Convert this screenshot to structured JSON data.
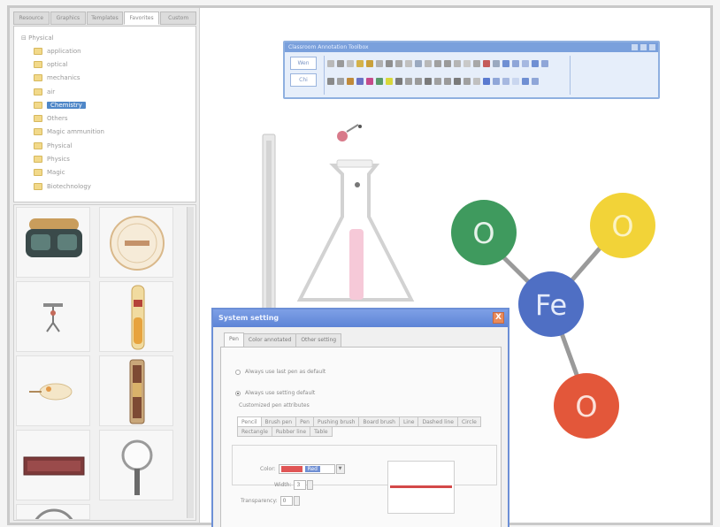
{
  "left_panel": {
    "tabs": [
      "Resource",
      "Graphics",
      "Templates",
      "Favorites",
      "Custom"
    ],
    "active_tab": 3,
    "tree": {
      "root": "Physical",
      "items": [
        "application",
        "optical",
        "mechanics",
        "air",
        "Chemistry",
        "Others",
        "Magic ammunition",
        "Physical",
        "Physics",
        "Magic",
        "Biotechnology"
      ],
      "selected": 4
    },
    "gallery_icons": [
      "goggles-icon",
      "thermometer-dial-icon",
      "tripod-icon",
      "test-tube-icon",
      "lamp-icon",
      "test-tube-rack-icon",
      "slide-icon",
      "magnifier-icon",
      "dial-icon"
    ]
  },
  "toolbar": {
    "title": "Classroom  Annotation  Toolbox",
    "mode_buttons": [
      "Wen",
      "Chi"
    ],
    "accent": "#8fb0e0"
  },
  "molecule": {
    "atoms": [
      {
        "label": "Fe",
        "color": "#4f6fc4"
      },
      {
        "label": "O",
        "color": "#3f9a5e"
      },
      {
        "label": "O",
        "color": "#f2d338"
      },
      {
        "label": "O",
        "color": "#e3573a"
      }
    ]
  },
  "dialog": {
    "title": "System setting",
    "close": "X",
    "tabs": [
      "Pen",
      "Color annotated",
      "Other setting"
    ],
    "active_tab": 0,
    "radio_1": "Always use last pen as default",
    "radio_2": "Always use setting default",
    "group_label": "Customized pen attributes",
    "pen_tabs": [
      "Pencil",
      "Brush pen",
      "Pen",
      "Pushing brush",
      "Board brush",
      "Line",
      "Dashed line",
      "Circle",
      "Rectangle",
      "Rubber line",
      "Table"
    ],
    "active_pen_tab": 0,
    "color_label": "Color:",
    "color_value": "Red",
    "color_hex": "#e05555",
    "width_label": "Width:",
    "width_value": "3",
    "transparency_label": "Transparency:",
    "transparency_value": "0"
  }
}
